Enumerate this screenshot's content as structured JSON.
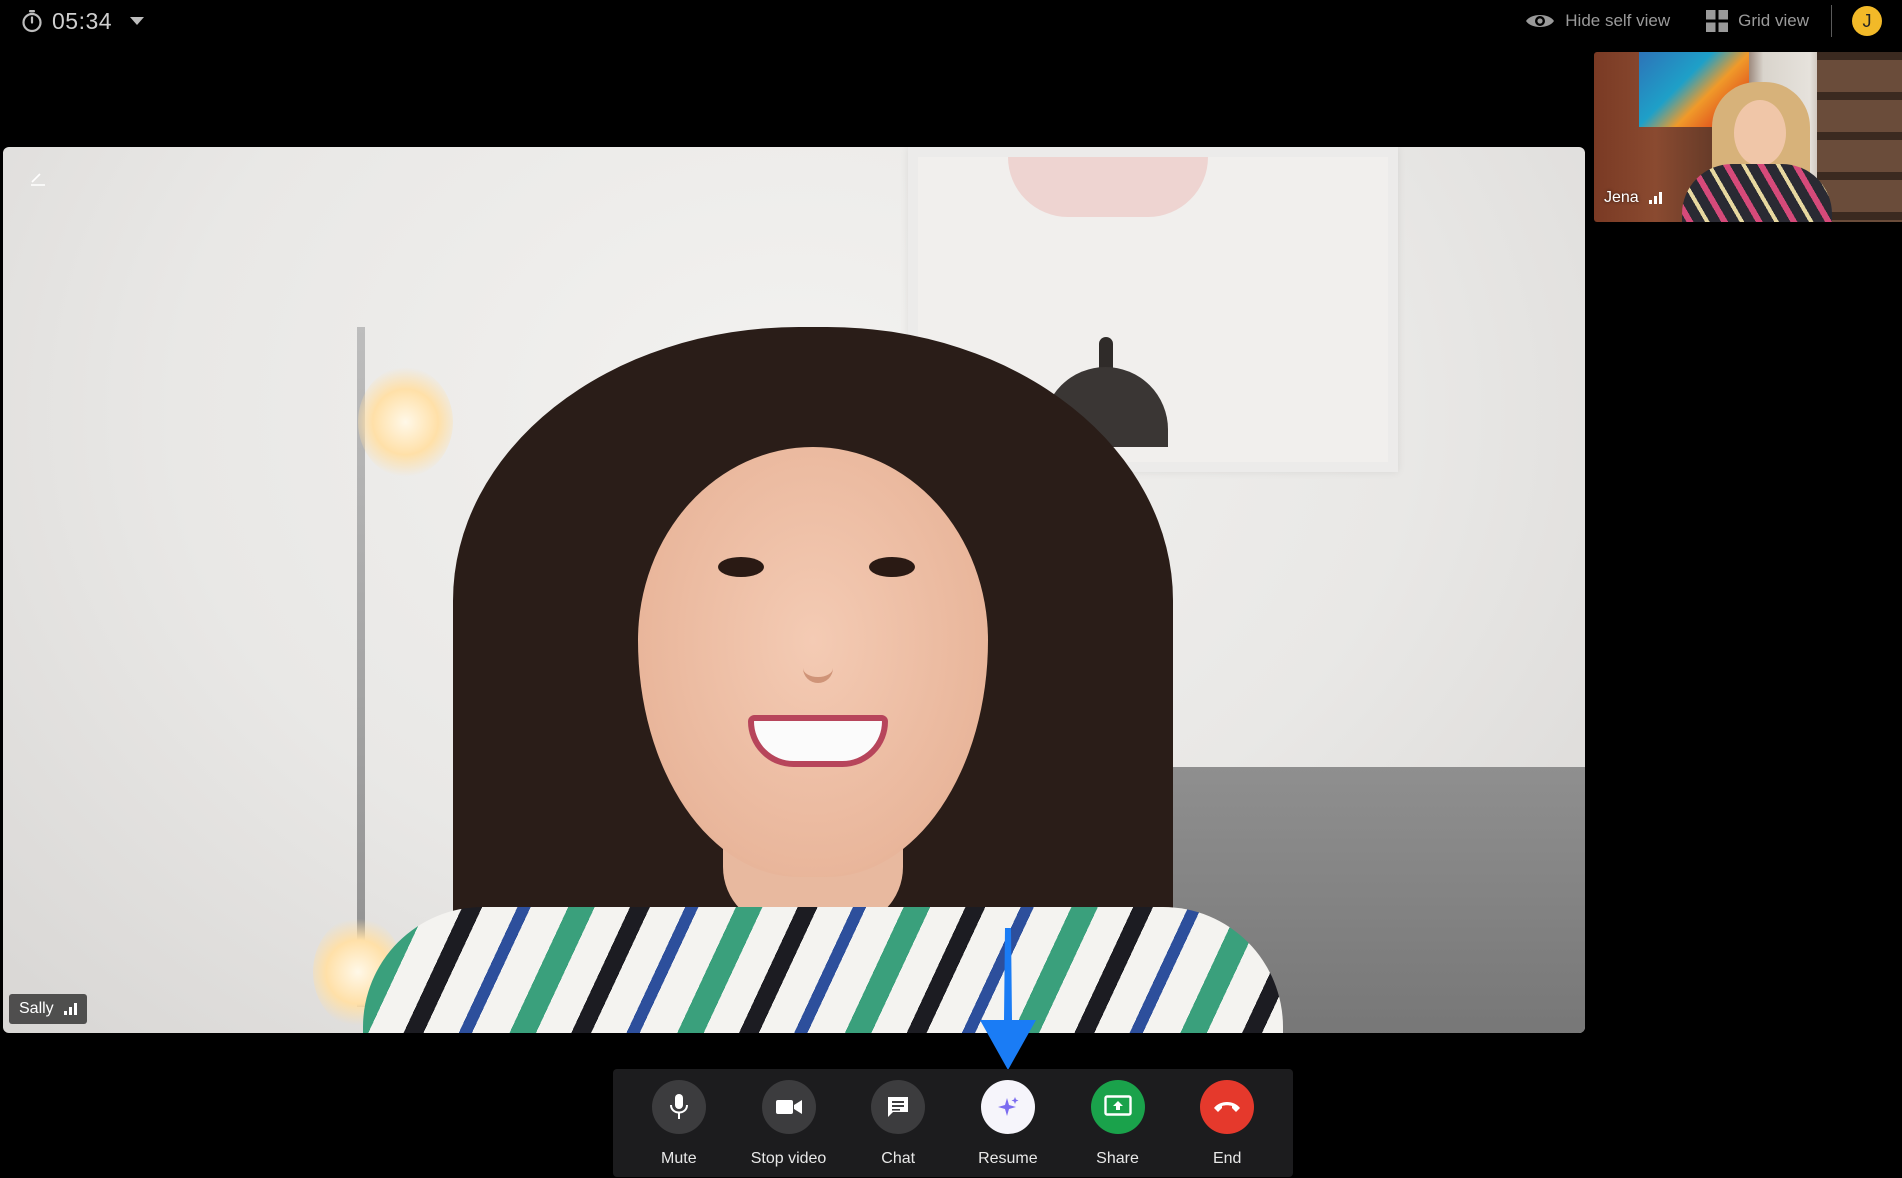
{
  "topbar": {
    "timer_text": "05:34",
    "hide_self_view_label": "Hide self view",
    "grid_view_label": "Grid view",
    "avatar_initial": "J"
  },
  "main_video": {
    "participant_name": "Sally"
  },
  "self_view": {
    "participant_name": "Jena"
  },
  "controls": {
    "mute_label": "Mute",
    "stop_video_label": "Stop video",
    "chat_label": "Chat",
    "resume_label": "Resume",
    "share_label": "Share",
    "end_label": "End"
  },
  "colors": {
    "arrow": "#1a7cf5",
    "share": "#1aa24b",
    "end": "#e5392c",
    "avatar": "#f2b928",
    "resume_icon": "#7b6cf0"
  },
  "icons": {
    "timer": "stopwatch-icon",
    "hide_self_view": "eye-icon",
    "grid_view": "grid-icon",
    "mute": "microphone-icon",
    "stop_video": "video-camera-icon",
    "chat": "chat-bubble-icon",
    "resume": "sparkle-icon",
    "share": "share-screen-icon",
    "end": "phone-hangup-icon",
    "signal": "signal-bars-icon"
  }
}
